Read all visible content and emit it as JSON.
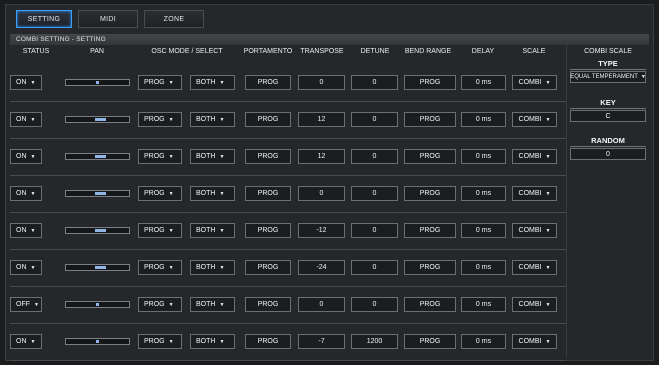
{
  "tabs": [
    {
      "label": "SETTING",
      "active": true
    },
    {
      "label": "MIDI",
      "active": false
    },
    {
      "label": "ZONE",
      "active": false
    }
  ],
  "section_title": "COMBI SETTING - SETTING",
  "columns": {
    "status": "STATUS",
    "pan": "PAN",
    "osc": "OSC MODE / SELECT",
    "portamento": "PORTAMENTO",
    "transpose": "TRANSPOSE",
    "detune": "DETUNE",
    "bend_range": "BEND RANGE",
    "delay": "DELAY",
    "scale": "SCALE"
  },
  "rows": [
    {
      "status": "ON",
      "pan": 0.5,
      "osc_mode": "PROG",
      "osc_select": "BOTH",
      "portamento": "PROG",
      "transpose": "0",
      "detune": "0",
      "bend_range": "PROG",
      "delay": "0 ms",
      "scale": "COMBI"
    },
    {
      "status": "ON",
      "pan": 0.54,
      "osc_mode": "PROG",
      "osc_select": "BOTH",
      "portamento": "PROG",
      "transpose": "12",
      "detune": "0",
      "bend_range": "PROG",
      "delay": "0 ms",
      "scale": "COMBI"
    },
    {
      "status": "ON",
      "pan": 0.54,
      "osc_mode": "PROG",
      "osc_select": "BOTH",
      "portamento": "PROG",
      "transpose": "12",
      "detune": "0",
      "bend_range": "PROG",
      "delay": "0 ms",
      "scale": "COMBI"
    },
    {
      "status": "ON",
      "pan": 0.54,
      "osc_mode": "PROG",
      "osc_select": "BOTH",
      "portamento": "PROG",
      "transpose": "0",
      "detune": "0",
      "bend_range": "PROG",
      "delay": "0 ms",
      "scale": "COMBI"
    },
    {
      "status": "ON",
      "pan": 0.54,
      "osc_mode": "PROG",
      "osc_select": "BOTH",
      "portamento": "PROG",
      "transpose": "-12",
      "detune": "0",
      "bend_range": "PROG",
      "delay": "0 ms",
      "scale": "COMBI"
    },
    {
      "status": "ON",
      "pan": 0.54,
      "osc_mode": "PROG",
      "osc_select": "BOTH",
      "portamento": "PROG",
      "transpose": "-24",
      "detune": "0",
      "bend_range": "PROG",
      "delay": "0 ms",
      "scale": "COMBI"
    },
    {
      "status": "OFF",
      "pan": 0.5,
      "osc_mode": "PROG",
      "osc_select": "BOTH",
      "portamento": "PROG",
      "transpose": "0",
      "detune": "0",
      "bend_range": "PROG",
      "delay": "0 ms",
      "scale": "COMBI"
    },
    {
      "status": "ON",
      "pan": 0.5,
      "osc_mode": "PROG",
      "osc_select": "BOTH",
      "portamento": "PROG",
      "transpose": "-7",
      "detune": "1200",
      "bend_range": "PROG",
      "delay": "0 ms",
      "scale": "COMBI"
    }
  ],
  "combi_scale": {
    "title": "COMBI SCALE",
    "type_label": "TYPE",
    "type_value": "EQUAL TEMPERAMENT",
    "key_label": "KEY",
    "key_value": "C",
    "random_label": "RANDOM",
    "random_value": "0"
  },
  "dropdown_glyph": "▼",
  "accent_color": "#3aa0ff"
}
